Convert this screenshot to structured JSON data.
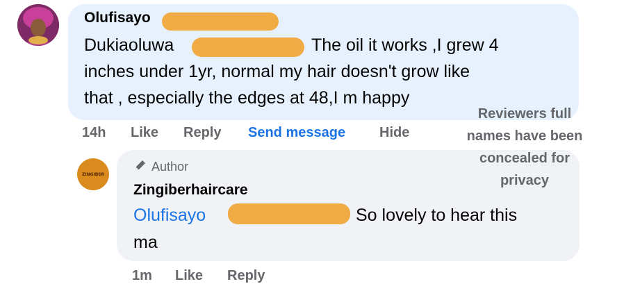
{
  "comment": {
    "author_first_name": "Olufisayo",
    "line1_prefix": "Dukiaoluwa",
    "line1_text": "The oil it works ,I grew 4",
    "line2": "inches under 1yr, normal my hair doesn't grow like",
    "line3": "that , especially the edges at 48,I m happy",
    "actions": {
      "time": "14h",
      "like": "Like",
      "reply": "Reply",
      "send_message": "Send message",
      "hide": "Hide"
    }
  },
  "reply": {
    "badge": "Author",
    "author_name": "Zingiberhaircare",
    "mention": "Olufisayo",
    "text": "So lovely to hear this",
    "text_cont": "ma",
    "avatar_text": "ZINGIBER",
    "actions": {
      "time": "1m",
      "like": "Like",
      "reply": "Reply"
    }
  },
  "note": {
    "line1": "Reviewers full",
    "line2": "names have been",
    "line3": "concealed for",
    "line4": "privacy"
  },
  "colors": {
    "bubble_main": "#e7f1fd",
    "bubble_reply": "#f0f2f5",
    "redaction": "#f0ab45",
    "link_blue": "#1b74e4",
    "meta_gray": "#65676b"
  }
}
